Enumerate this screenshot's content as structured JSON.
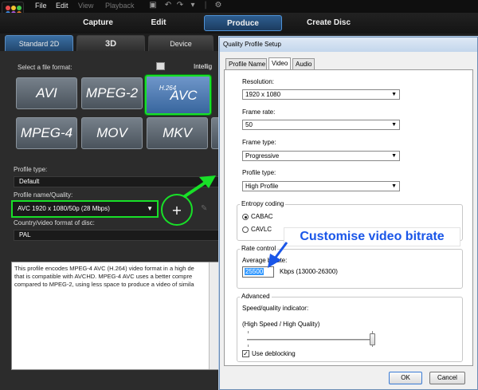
{
  "menu": {
    "file": "File",
    "edit": "Edit",
    "view": "View",
    "playback": "Playback"
  },
  "mode_tabs": {
    "capture": "Capture",
    "edit": "Edit",
    "produce": "Produce",
    "create_disc": "Create Disc"
  },
  "sub_tabs": {
    "standard_2d": "Standard 2D",
    "three_d": "3D",
    "device": "Device"
  },
  "intelligent_label": "Intellig",
  "left_panel": {
    "select_format_label": "Select a file format:",
    "formats": {
      "avi": "AVI",
      "mpeg2": "MPEG-2",
      "h264": "H.264",
      "avc": "AVC",
      "mpeg4": "MPEG-4",
      "mov": "MOV",
      "mkv": "MKV"
    },
    "selected_format": "H.264 AVC",
    "profile_type_label": "Profile type:",
    "profile_type_value": "Default",
    "profile_quality_label": "Profile name/Quality:",
    "profile_quality_value": "AVC 1920 x 1080/50p (28 Mbps)",
    "add_button": "+",
    "country_label": "Country/video format of disc:",
    "country_value": "PAL",
    "description": [
      "This profile encodes MPEG-4 AVC (H.264) video format in a high de",
      "that is compatible with AVCHD. MPEG-4 AVC uses a better compre",
      "compared to MPEG-2, using less space to produce a video of simila"
    ]
  },
  "dialog": {
    "title": "Quality Profile Setup",
    "tabs": {
      "profile_name": "Profile Name",
      "video": "Video",
      "audio": "Audio"
    },
    "active_tab": "Video",
    "resolution_label": "Resolution:",
    "resolution_value": "1920 x 1080",
    "frame_rate_label": "Frame rate:",
    "frame_rate_value": "50",
    "frame_type_label": "Frame type:",
    "frame_type_value": "Progressive",
    "profile_type_label": "Profile type:",
    "profile_type_value": "High Profile",
    "entropy_label": "Entropy coding",
    "cabac": "CABAC",
    "cavlc": "CAVLC",
    "entropy_selected": "CABAC",
    "rate_control_label": "Rate control",
    "avg_bitrate_label": "Average bitrate:",
    "bitrate_value": "25500",
    "bitrate_unit": "Kbps (13000-26300)",
    "advanced_label": "Advanced",
    "speed_label": "Speed/quality indicator:",
    "speed_value_label": "(High Speed / High Quality)",
    "speed_slider_fraction": 1.0,
    "deblocking_label": "Use deblocking",
    "deblocking_checked": true,
    "ok": "OK",
    "cancel": "Cancel"
  },
  "annotation": {
    "callout": "Customise video bitrate"
  },
  "colors": {
    "highlight_green": "#18e028",
    "callout_blue": "#1a56e8",
    "produce_blue": "#2d5d8f"
  }
}
